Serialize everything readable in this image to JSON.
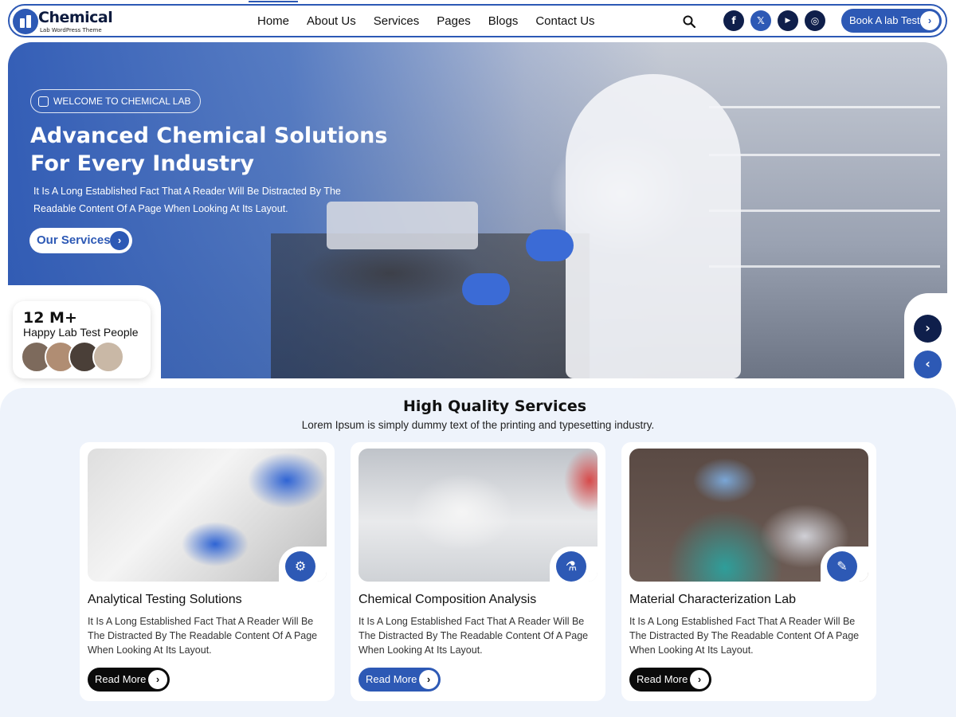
{
  "brand": {
    "name": "Chemical",
    "tagline": "Lab WordPress Theme",
    "primary_color": "#2d59b5",
    "dark_color": "#0f1f4b"
  },
  "nav": {
    "items": [
      {
        "label": "Home",
        "active": true
      },
      {
        "label": "About Us",
        "active": false
      },
      {
        "label": "Services",
        "active": false
      },
      {
        "label": "Pages",
        "active": false
      },
      {
        "label": "Blogs",
        "active": false
      },
      {
        "label": "Contact Us",
        "active": false
      }
    ],
    "search_icon": "search-icon",
    "social": [
      {
        "name": "facebook-icon",
        "glyph": "f"
      },
      {
        "name": "x-icon",
        "glyph": "𝕏"
      },
      {
        "name": "youtube-icon",
        "glyph": "▶"
      },
      {
        "name": "instagram-icon",
        "glyph": "◎"
      }
    ],
    "cta_label": "Book A lab Test"
  },
  "hero": {
    "badge": "WELCOME TO CHEMICAL LAB",
    "title_line1": "Advanced Chemical Solutions",
    "title_line2": "For Every Industry",
    "description": "It Is A Long Established Fact That A Reader Will Be Distracted By The Readable Content Of A Page When Looking At Its Layout.",
    "button_label": "Our Services",
    "stat_number": "12 M+",
    "stat_label": "Happy Lab Test People",
    "next_glyph": "›",
    "prev_glyph": "‹"
  },
  "services": {
    "title": "High Quality Services",
    "subtitle": "Lorem Ipsum is simply dummy text of the printing and typesetting industry.",
    "cards": [
      {
        "title": "Analytical Testing Solutions",
        "description": "It Is A Long Established Fact That A Reader Will Be The Distracted By The Readable Content Of A Page When Looking At Its Layout.",
        "button": "Read More",
        "icon": "microscope-gear-icon",
        "glyph": "⚙"
      },
      {
        "title": "Chemical Composition Analysis",
        "description": "It Is A Long Established Fact That A Reader Will Be The Distracted By The Readable Content Of A Page When Looking At Its Layout.",
        "button": "Read More",
        "icon": "flask-icon",
        "glyph": "⚗"
      },
      {
        "title": "Material Characterization Lab",
        "description": "It Is A Long Established Fact That A Reader Will Be The Distracted By The Readable Content Of A Page When Looking At Its Layout.",
        "button": "Read More",
        "icon": "pipette-icon",
        "glyph": "✎"
      }
    ]
  }
}
